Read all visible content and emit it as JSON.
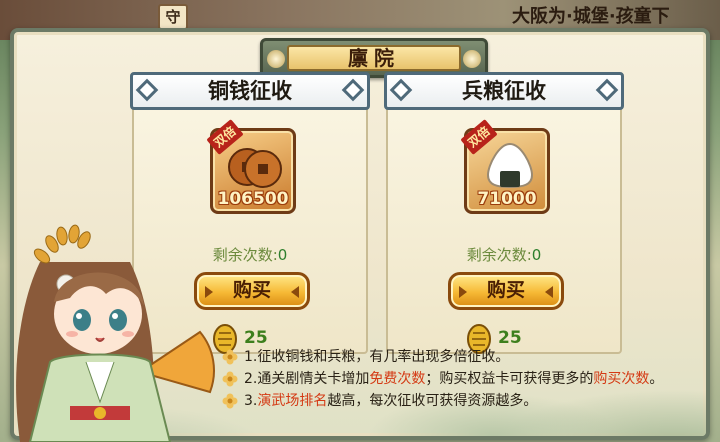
{
  "background": {
    "left_text": "守",
    "right_text": "大阪为·城堡·孩童下"
  },
  "title": "廪院",
  "cards": [
    {
      "header": "铜钱征收",
      "badge": "双倍",
      "amount": "106500",
      "remain_label": "剩余次数:",
      "remain_value": "0",
      "buy_label": "购买",
      "price": "25",
      "icon": "copper-coins-icon"
    },
    {
      "header": "兵粮征收",
      "badge": "双倍",
      "amount": "71000",
      "remain_label": "剩余次数:",
      "remain_value": "0",
      "buy_label": "购买",
      "price": "25",
      "icon": "onigiri-icon"
    }
  ],
  "notes": [
    {
      "pre": "1.征收铜钱和兵粮，有几率出现多倍征收。",
      "hl1": "",
      "mid": "",
      "hl2": "",
      "post": ""
    },
    {
      "pre": "2.通关剧情关卡增加",
      "hl1": "免费次数",
      "mid": "；购买权益卡可获得更多的",
      "hl2": "购买次数",
      "post": "。"
    },
    {
      "pre": "3.",
      "hl1": "演武场排名",
      "mid": "越高，每次征收可获得资源越多。",
      "hl2": "",
      "post": ""
    }
  ],
  "colors": {
    "highlight": "#d43a14",
    "remain_value": "#2d7f2d",
    "price": "#3d7f1d"
  }
}
